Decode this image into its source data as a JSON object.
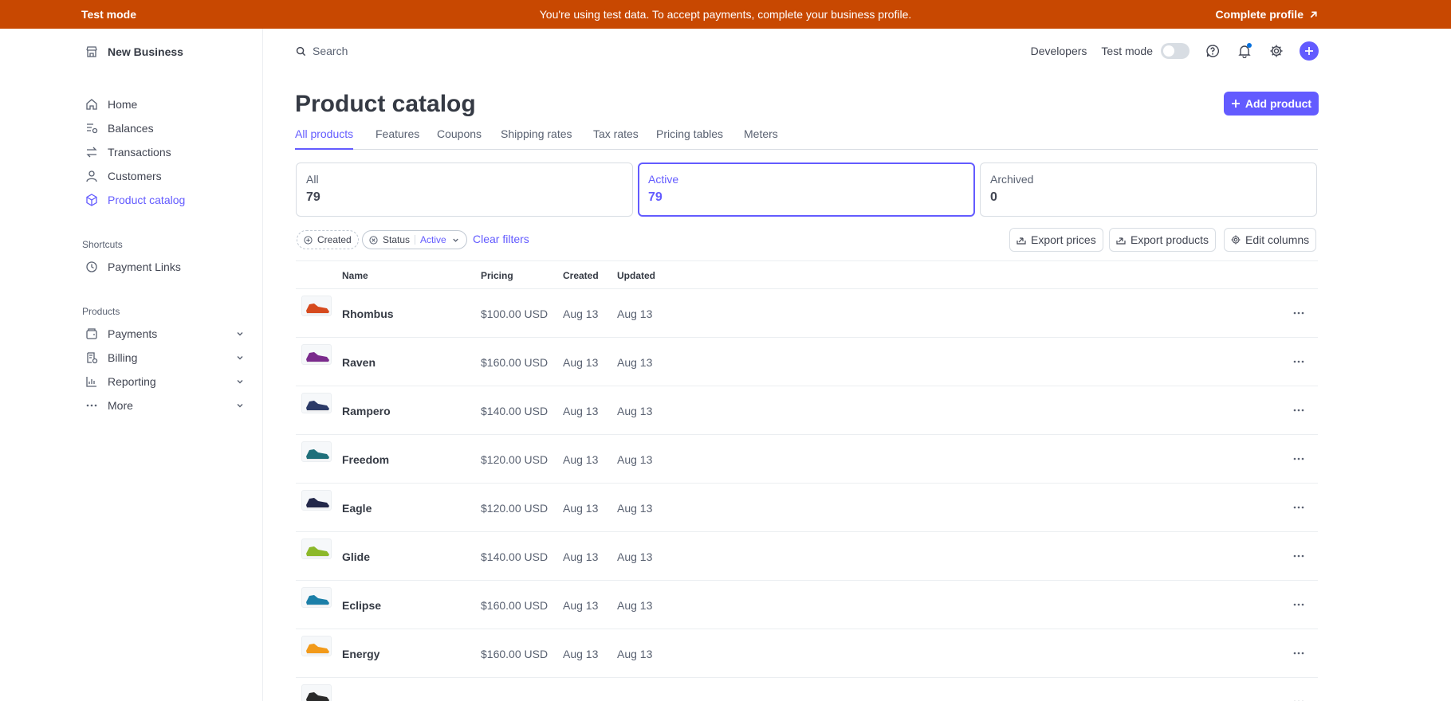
{
  "banner": {
    "label": "Test mode",
    "message": "You're using test data. To accept payments, complete your business profile.",
    "action": "Complete profile",
    "color": "#c84801"
  },
  "sidebar": {
    "business": "New Business",
    "items": [
      {
        "label": "Home",
        "icon": "home-icon"
      },
      {
        "label": "Balances",
        "icon": "balances-icon"
      },
      {
        "label": "Transactions",
        "icon": "transactions-icon"
      },
      {
        "label": "Customers",
        "icon": "customers-icon"
      },
      {
        "label": "Product catalog",
        "icon": "product-catalog-icon",
        "active": true
      }
    ],
    "shortcuts_label": "Shortcuts",
    "shortcuts": [
      {
        "label": "Payment Links",
        "icon": "clock-icon"
      }
    ],
    "products_label": "Products",
    "products": [
      {
        "label": "Payments",
        "icon": "payments-icon"
      },
      {
        "label": "Billing",
        "icon": "billing-icon"
      },
      {
        "label": "Reporting",
        "icon": "reporting-icon"
      },
      {
        "label": "More",
        "icon": "more-dots-icon"
      }
    ]
  },
  "topbar": {
    "search_placeholder": "Search",
    "developers": "Developers",
    "test_mode": "Test mode"
  },
  "page": {
    "title": "Product catalog",
    "add_button": "Add product",
    "accent": "#635bff"
  },
  "tabs": [
    "All products",
    "Features",
    "Coupons",
    "Shipping rates",
    "Tax rates",
    "Pricing tables",
    "Meters"
  ],
  "counts": [
    {
      "label": "All",
      "value": "79"
    },
    {
      "label": "Active",
      "value": "79",
      "active": true
    },
    {
      "label": "Archived",
      "value": "0"
    }
  ],
  "filters": {
    "created": "Created",
    "status": "Status",
    "status_value": "Active",
    "clear": "Clear filters"
  },
  "toolbar": {
    "export_prices": "Export prices",
    "export_products": "Export products",
    "edit_columns": "Edit columns"
  },
  "table": {
    "columns": [
      "Name",
      "Pricing",
      "Created",
      "Updated"
    ],
    "rows": [
      {
        "name": "Rhombus",
        "pricing": "$100.00 USD",
        "created": "Aug 13",
        "updated": "Aug 13",
        "shoe": "#d64a1e"
      },
      {
        "name": "Raven",
        "pricing": "$160.00 USD",
        "created": "Aug 13",
        "updated": "Aug 13",
        "shoe": "#7a2a8c"
      },
      {
        "name": "Rampero",
        "pricing": "$140.00 USD",
        "created": "Aug 13",
        "updated": "Aug 13",
        "shoe": "#2b3a67"
      },
      {
        "name": "Freedom",
        "pricing": "$120.00 USD",
        "created": "Aug 13",
        "updated": "Aug 13",
        "shoe": "#1f6f7a"
      },
      {
        "name": "Eagle",
        "pricing": "$120.00 USD",
        "created": "Aug 13",
        "updated": "Aug 13",
        "shoe": "#23284a"
      },
      {
        "name": "Glide",
        "pricing": "$140.00 USD",
        "created": "Aug 13",
        "updated": "Aug 13",
        "shoe": "#8cb82a"
      },
      {
        "name": "Eclipse",
        "pricing": "$160.00 USD",
        "created": "Aug 13",
        "updated": "Aug 13",
        "shoe": "#1b7fa8"
      },
      {
        "name": "Energy",
        "pricing": "$160.00 USD",
        "created": "Aug 13",
        "updated": "Aug 13",
        "shoe": "#f29a1a"
      },
      {
        "name": "",
        "pricing": "",
        "created": "",
        "updated": "",
        "shoe": "#2a2a2a"
      }
    ]
  }
}
